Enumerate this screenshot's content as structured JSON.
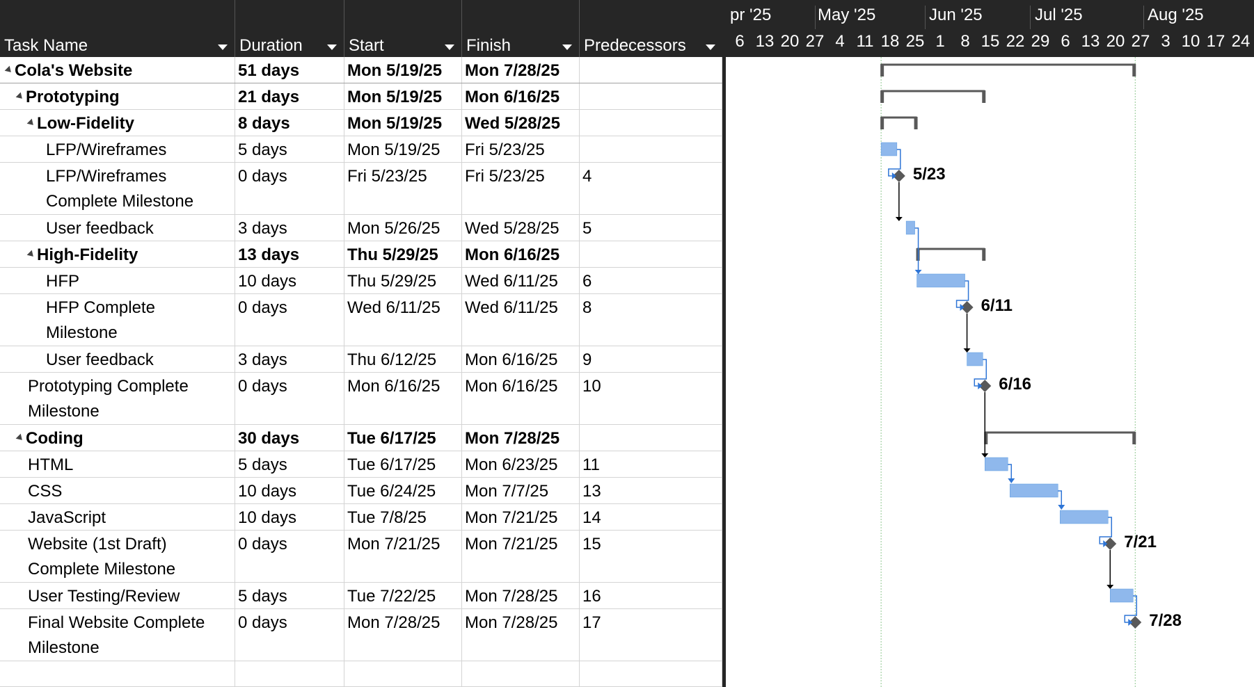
{
  "columns": {
    "task_name": "Task Name",
    "duration": "Duration",
    "start": "Start",
    "finish": "Finish",
    "predecessors": "Predecessors"
  },
  "timescale": {
    "months": [
      "pr '25",
      "May '25",
      "Jun '25",
      "Jul '25",
      "Aug '25"
    ],
    "weeks": [
      "6",
      "13",
      "20",
      "27",
      "4",
      "11",
      "18",
      "25",
      "1",
      "8",
      "15",
      "22",
      "29",
      "6",
      "13",
      "20",
      "27",
      "3",
      "10",
      "17",
      "24"
    ]
  },
  "tasks": [
    {
      "id": 0,
      "name": "Cola's Website",
      "duration": "51 days",
      "start": "Mon 5/19/25",
      "finish": "Mon 7/28/25",
      "pred": "",
      "level": 0,
      "bold": true,
      "collapse": true,
      "type": "summary"
    },
    {
      "id": 1,
      "name": "Prototyping",
      "duration": "21 days",
      "start": "Mon 5/19/25",
      "finish": "Mon 6/16/25",
      "pred": "",
      "level": 1,
      "bold": true,
      "collapse": true,
      "type": "summary"
    },
    {
      "id": 2,
      "name": "Low-Fidelity",
      "duration": "8 days",
      "start": "Mon 5/19/25",
      "finish": "Wed 5/28/25",
      "pred": "",
      "level": 2,
      "bold": true,
      "collapse": true,
      "type": "summary"
    },
    {
      "id": 3,
      "name": "LFP/Wireframes",
      "duration": "5 days",
      "start": "Mon 5/19/25",
      "finish": "Fri 5/23/25",
      "pred": "",
      "level": 3,
      "bold": false,
      "type": "task"
    },
    {
      "id": 4,
      "name": "LFP/Wireframes Complete Milestone",
      "duration": "0 days",
      "start": "Fri 5/23/25",
      "finish": "Fri 5/23/25",
      "pred": "4",
      "level": 3,
      "bold": false,
      "type": "milestone",
      "label": "5/23"
    },
    {
      "id": 5,
      "name": "User feedback",
      "duration": "3 days",
      "start": "Mon 5/26/25",
      "finish": "Wed 5/28/25",
      "pred": "5",
      "level": 3,
      "bold": false,
      "type": "task"
    },
    {
      "id": 6,
      "name": "High-Fidelity",
      "duration": "13 days",
      "start": "Thu 5/29/25",
      "finish": "Mon 6/16/25",
      "pred": "",
      "level": 2,
      "bold": true,
      "collapse": true,
      "type": "summary"
    },
    {
      "id": 7,
      "name": "HFP",
      "duration": "10 days",
      "start": "Thu 5/29/25",
      "finish": "Wed 6/11/25",
      "pred": "6",
      "level": 3,
      "bold": false,
      "type": "task"
    },
    {
      "id": 8,
      "name": "HFP Complete Milestone",
      "duration": "0 days",
      "start": "Wed 6/11/25",
      "finish": "Wed 6/11/25",
      "pred": "8",
      "level": 3,
      "bold": false,
      "type": "milestone",
      "label": "6/11"
    },
    {
      "id": 9,
      "name": "User feedback",
      "duration": "3 days",
      "start": "Thu 6/12/25",
      "finish": "Mon 6/16/25",
      "pred": "9",
      "level": 3,
      "bold": false,
      "type": "task"
    },
    {
      "id": 10,
      "name": "Prototyping Complete Milestone",
      "duration": "0 days",
      "start": "Mon 6/16/25",
      "finish": "Mon 6/16/25",
      "pred": "10",
      "level": 2,
      "bold": false,
      "type": "milestone",
      "label": "6/16"
    },
    {
      "id": 11,
      "name": "Coding",
      "duration": "30 days",
      "start": "Tue 6/17/25",
      "finish": "Mon 7/28/25",
      "pred": "",
      "level": 1,
      "bold": true,
      "collapse": true,
      "type": "summary"
    },
    {
      "id": 12,
      "name": "HTML",
      "duration": "5 days",
      "start": "Tue 6/17/25",
      "finish": "Mon 6/23/25",
      "pred": "11",
      "level": 2,
      "bold": false,
      "type": "task"
    },
    {
      "id": 13,
      "name": "CSS",
      "duration": "10 days",
      "start": "Tue 6/24/25",
      "finish": "Mon 7/7/25",
      "pred": "13",
      "level": 2,
      "bold": false,
      "type": "task"
    },
    {
      "id": 14,
      "name": "JavaScript",
      "duration": "10 days",
      "start": "Tue 7/8/25",
      "finish": "Mon 7/21/25",
      "pred": "14",
      "level": 2,
      "bold": false,
      "type": "task"
    },
    {
      "id": 15,
      "name": "Website (1st Draft) Complete Milestone",
      "duration": "0 days",
      "start": "Mon 7/21/25",
      "finish": "Mon 7/21/25",
      "pred": "15",
      "level": 2,
      "bold": false,
      "type": "milestone",
      "label": "7/21"
    },
    {
      "id": 16,
      "name": "User Testing/Review",
      "duration": "5 days",
      "start": "Tue 7/22/25",
      "finish": "Mon 7/28/25",
      "pred": "16",
      "level": 2,
      "bold": false,
      "type": "task"
    },
    {
      "id": 17,
      "name": "Final Website Complete Milestone",
      "duration": "0 days",
      "start": "Mon 7/28/25",
      "finish": "Mon 7/28/25",
      "pred": "17",
      "level": 2,
      "bold": false,
      "type": "milestone",
      "label": "7/28"
    }
  ],
  "colors": {
    "header_bg": "#262626",
    "task_bar": "#8FB8EC",
    "task_bar_border": "#5B9BE0",
    "summary_bar": "#595959",
    "milestone": "#595959",
    "link_blue": "#2E75D6",
    "link_black": "#000000",
    "guide_line": "#8FC78F"
  }
}
